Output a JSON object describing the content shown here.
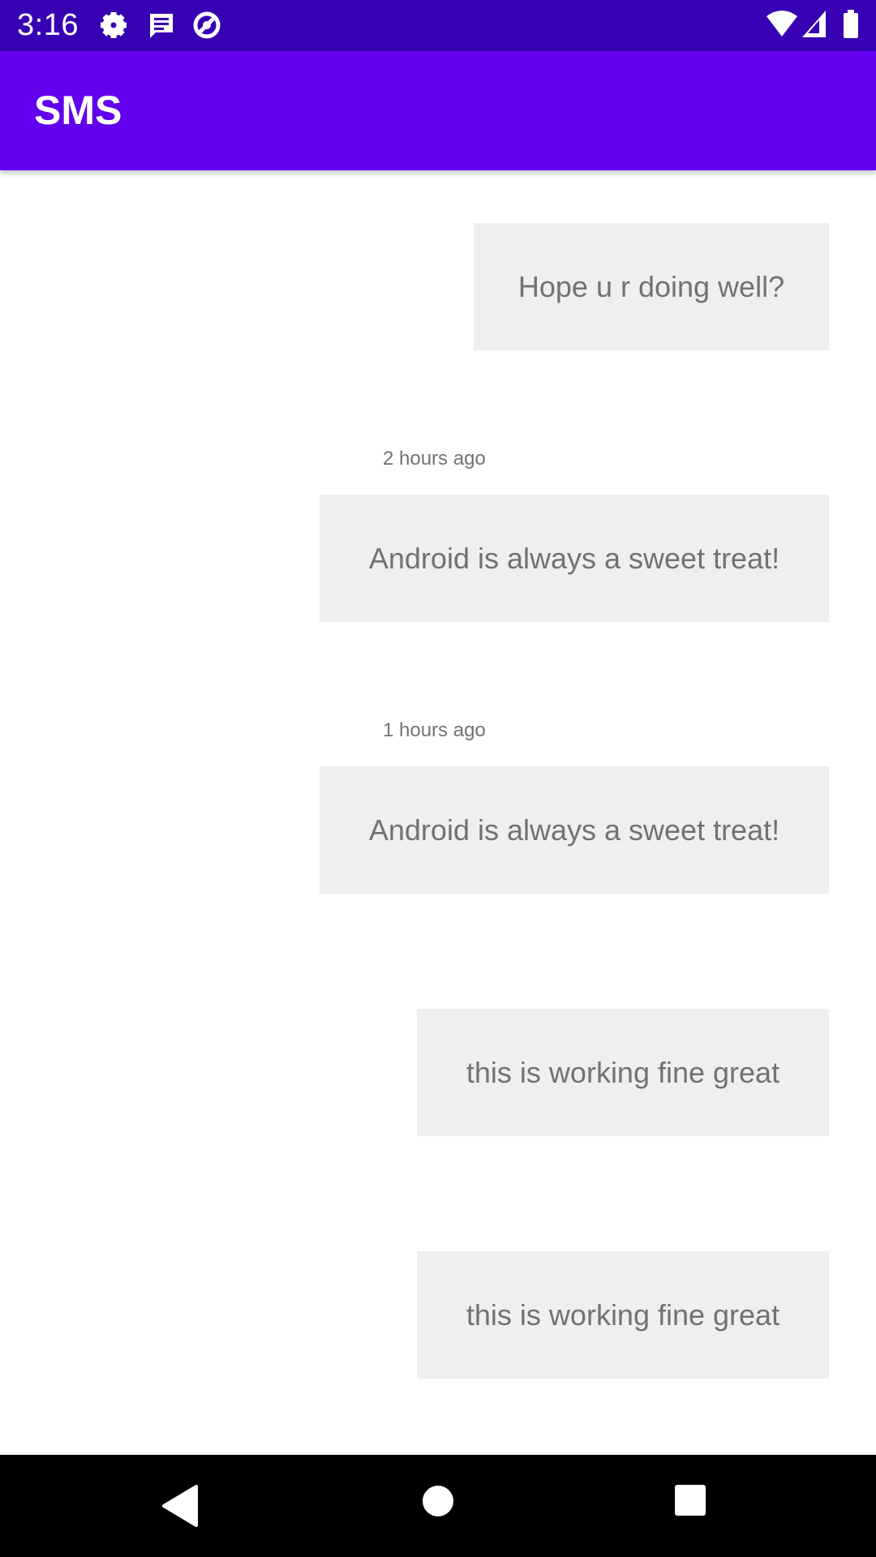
{
  "status_bar": {
    "time": "3:16",
    "left_icons": [
      "gear-icon",
      "message-icon",
      "sync-icon"
    ],
    "right_icons": [
      "wifi-icon",
      "signal-icon",
      "battery-icon"
    ]
  },
  "app_bar": {
    "title": "SMS",
    "color": "#6200ee"
  },
  "messages": [
    {
      "timestamp": "",
      "text": "Hope u r doing well?"
    },
    {
      "timestamp": "2 hours ago",
      "text": "Android is always a sweet treat!"
    },
    {
      "timestamp": "1 hours ago",
      "text": "Android is always a sweet treat!"
    },
    {
      "timestamp": "",
      "text": "this is working fine great"
    },
    {
      "timestamp": "",
      "text": "this is working fine great"
    }
  ],
  "nav_bar": {
    "buttons": [
      "back-icon",
      "home-icon",
      "recents-icon"
    ]
  }
}
